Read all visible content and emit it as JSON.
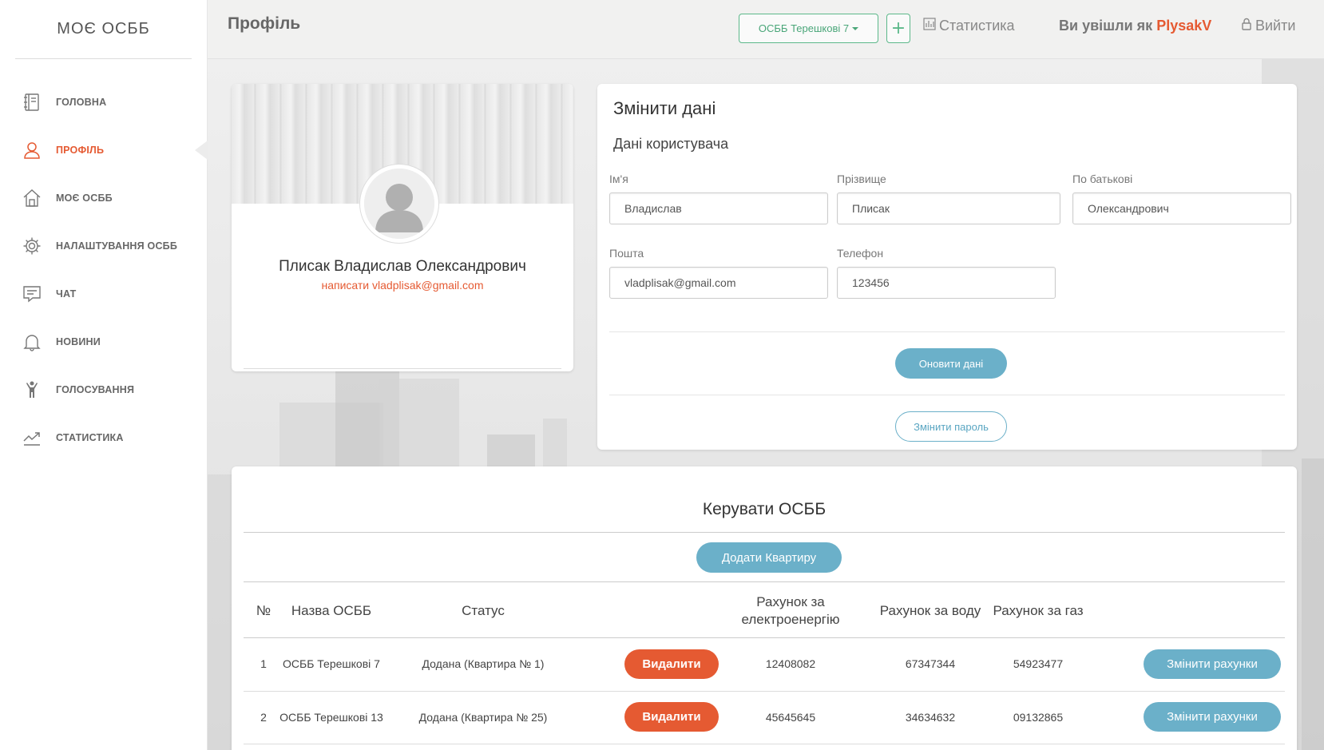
{
  "brand": "МОЄ ОСББ",
  "sidebar": {
    "items": [
      {
        "label": "ГОЛОВНА",
        "icon": "notebook-icon"
      },
      {
        "label": "ПРОФІЛЬ",
        "icon": "user-icon",
        "active": true
      },
      {
        "label": "МОЄ ОСББ",
        "icon": "home-icon"
      },
      {
        "label": "НАЛАШТУВАННЯ ОСББ",
        "icon": "gear-icon"
      },
      {
        "label": "ЧАТ",
        "icon": "chat-icon"
      },
      {
        "label": "НОВИНИ",
        "icon": "bell-icon"
      },
      {
        "label": "ГОЛОСУВАННЯ",
        "icon": "voting-person-icon"
      },
      {
        "label": "СТАТИСТИКА",
        "icon": "trend-icon"
      }
    ]
  },
  "header": {
    "title": "Профіль",
    "osbb_selected": "ОСББ Терешкові 7",
    "plus": "+",
    "stats_link": "Статистика",
    "login_prefix": "Ви увішли як",
    "username": "PlysakV",
    "logout": "Вийти"
  },
  "profile": {
    "full_name": "Плисак Владислав Олександрович",
    "write_label": "написати",
    "email": "vladplisak@gmail.com"
  },
  "edit": {
    "title": "Змінити дані",
    "subtitle": "Дані користувача",
    "fields": {
      "first_name": {
        "label": "Ім'я",
        "value": "Владислав"
      },
      "last_name": {
        "label": "Прізвище",
        "value": "Плисак"
      },
      "patronymic": {
        "label": "По батькові",
        "value": "Олександрович"
      },
      "email": {
        "label": "Пошта",
        "value": "vladplisak@gmail.com"
      },
      "phone": {
        "label": "Телефон",
        "value": "123456"
      }
    },
    "update_button": "Оновити дані",
    "password_button": "Змінити пароль"
  },
  "manage": {
    "title": "Керувати ОСББ",
    "add_button": "Додати Квартиру",
    "columns": [
      "№",
      "Назва ОСББ",
      "Статус",
      "Рахунок за електроенергію",
      "Рахунок за воду",
      "Рахунок за газ"
    ],
    "rows": [
      {
        "num": "1",
        "name": "ОСББ Терешкові 7",
        "status": "Додана (Квартира № 1)",
        "delete": "Видалити",
        "electricity": "12408082",
        "water": "67347344",
        "gas": "54923477",
        "change": "Змінити рахунки"
      },
      {
        "num": "2",
        "name": "ОСББ Терешкові 13",
        "status": "Додана (Квартира № 25)",
        "delete": "Видалити",
        "electricity": "45645645",
        "water": "34634632",
        "gas": "09132865",
        "change": "Змінити рахунки"
      }
    ]
  },
  "colors": {
    "accent": "#e55a32",
    "primary": "#6bb0c9",
    "success": "#5cb88a"
  }
}
